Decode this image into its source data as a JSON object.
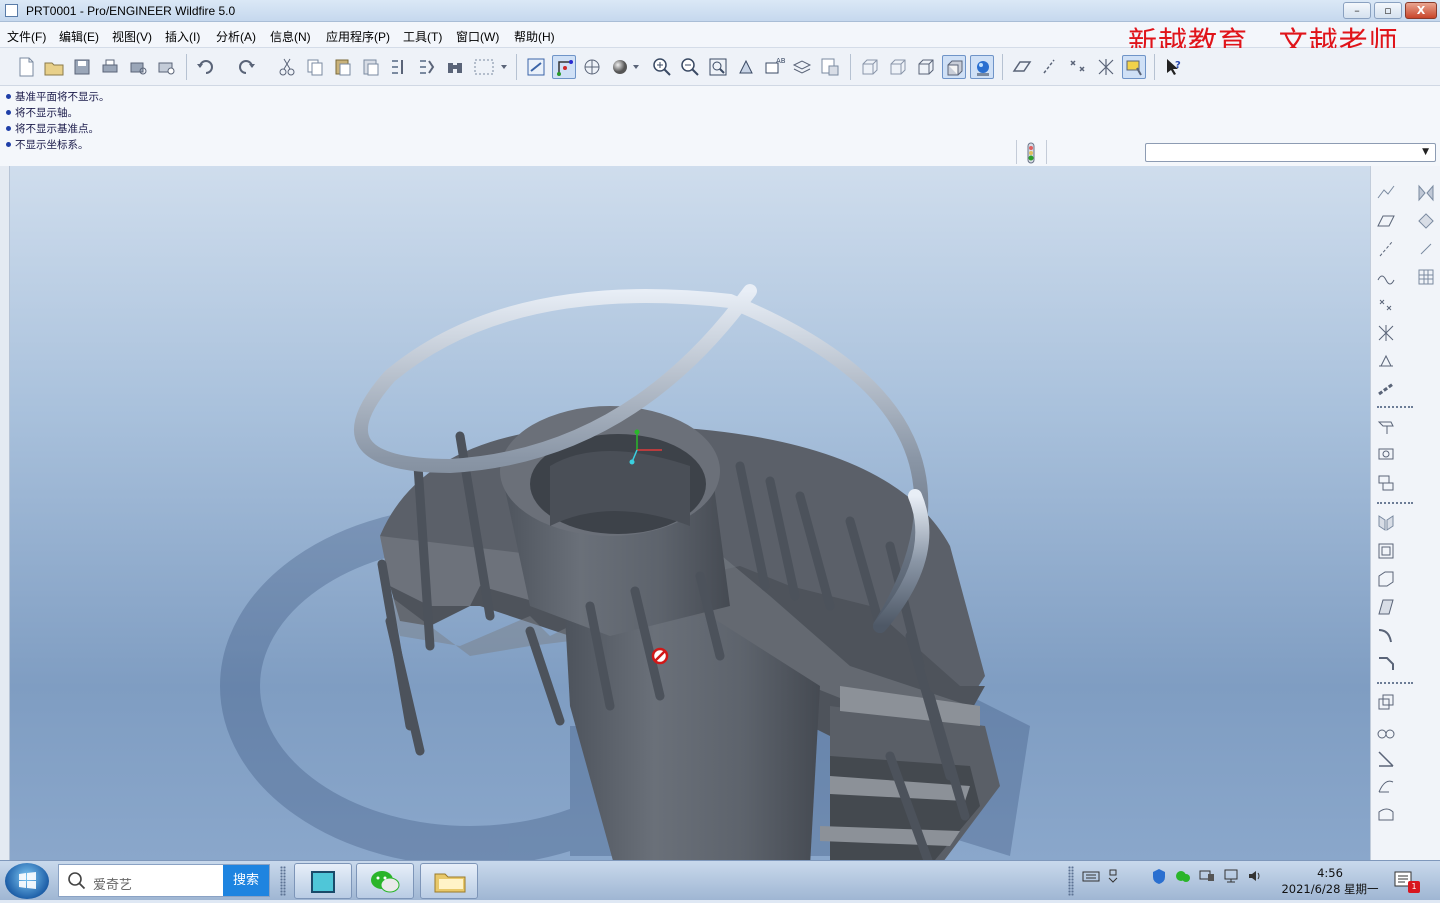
{
  "window": {
    "title": "PRT0001 - Pro/ENGINEER Wildfire 5.0",
    "min": "–",
    "restore": "▫",
    "close": "X"
  },
  "watermark": "新越教育   文越老师",
  "menu": [
    "文件(F)",
    "编辑(E)",
    "视图(V)",
    "插入(I)",
    "分析(A)",
    "信息(N)",
    "应用程序(P)",
    "工具(T)",
    "窗口(W)",
    "帮助(H)"
  ],
  "messages": [
    "基准平面将不显示。",
    "将不显示轴。",
    "将不显示基准点。",
    "不显示坐标系。"
  ],
  "filter": {
    "value": ""
  },
  "taskbar": {
    "search_placeholder": "爱奇艺",
    "search_button": "搜索",
    "time": "4:56",
    "date": "2021/6/28 星期一",
    "notification_count": "1"
  }
}
